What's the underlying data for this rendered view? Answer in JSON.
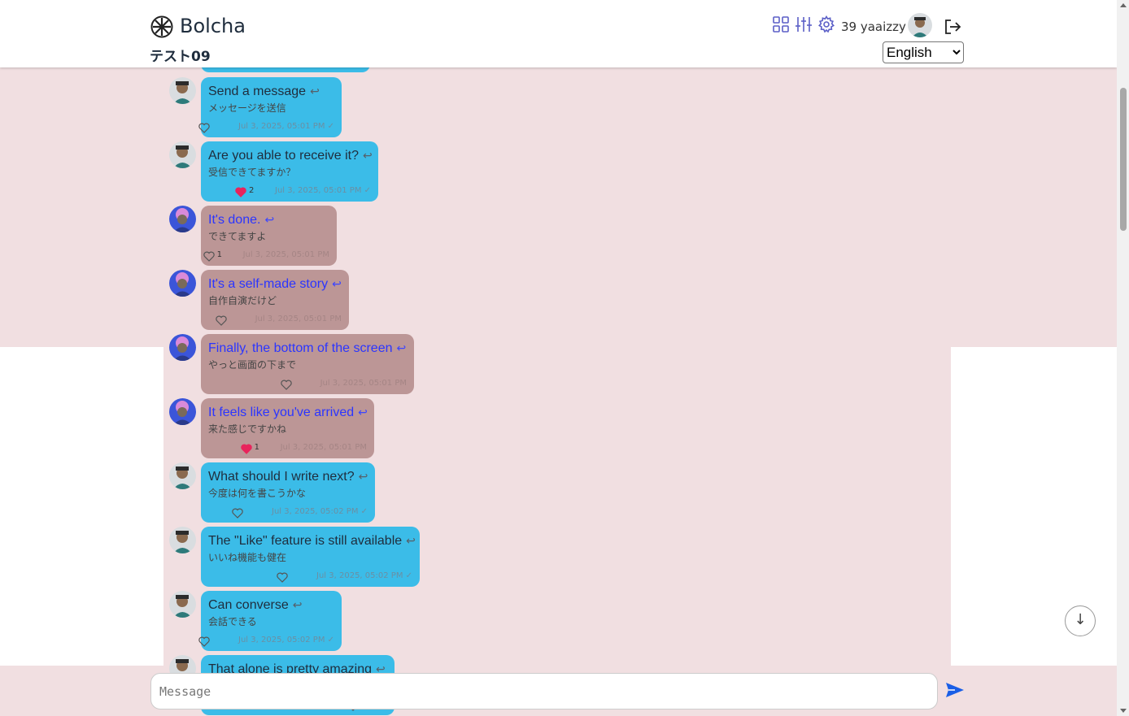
{
  "header": {
    "app_title": "Bolcha",
    "room_title": "テスト09",
    "user_count_label": "39 yaaizzy",
    "language": "English",
    "language_options": [
      "English"
    ]
  },
  "messages": [
    {
      "sender": "self",
      "text": "Send a message",
      "translation": "メッセージを送信",
      "liked": false,
      "likes": "",
      "timestamp": "Jul 3, 2025, 05:01 PM ✓"
    },
    {
      "sender": "self",
      "text": "Are you able to receive it?",
      "translation": "受信できてますか？",
      "liked": true,
      "likes": "2",
      "timestamp": "Jul 3, 2025, 05:01 PM ✓"
    },
    {
      "sender": "other",
      "text": "It's done.",
      "translation": "できてますよ",
      "liked": false,
      "likes": "1",
      "timestamp": "Jul 3, 2025, 05:01 PM"
    },
    {
      "sender": "other",
      "text": "It's a self-made story",
      "translation": "自作自演だけど",
      "liked": false,
      "likes": "",
      "timestamp": "Jul 3, 2025, 05:01 PM"
    },
    {
      "sender": "other",
      "text": "Finally, the bottom of the screen",
      "translation": "やっと画面の下まで",
      "liked": false,
      "likes": "",
      "timestamp": "Jul 3, 2025, 05:01 PM"
    },
    {
      "sender": "other",
      "text": "It feels like you've arrived",
      "translation": "来た感じですかね",
      "liked": true,
      "likes": "1",
      "timestamp": "Jul 3, 2025, 05:01 PM"
    },
    {
      "sender": "self",
      "text": "What should I write next?",
      "translation": "今度は何を書こうかな",
      "liked": false,
      "likes": "",
      "timestamp": "Jul 3, 2025, 05:02 PM ✓"
    },
    {
      "sender": "self",
      "text": "The \"Like\" feature is still available",
      "translation": "いいね機能も健在",
      "liked": false,
      "likes": "",
      "timestamp": "Jul 3, 2025, 05:02 PM ✓"
    },
    {
      "sender": "self",
      "text": "Can converse",
      "translation": "会話できる",
      "liked": false,
      "likes": "",
      "timestamp": "Jul 3, 2025, 05:02 PM ✓"
    },
    {
      "sender": "self",
      "text": "That alone is pretty amazing",
      "translation": "",
      "liked": false,
      "likes": "",
      "timestamp": ""
    }
  ],
  "composer": {
    "placeholder": "Message"
  },
  "scroll_down_label": "↓",
  "colors": {
    "my_bubble": "#3bbce8",
    "their_bubble": "#bc9696",
    "their_text": "#2b35ff",
    "heart_liked": "#e8245c",
    "accent": "#1a5ee6",
    "header_icons": "#5b5fc7"
  }
}
